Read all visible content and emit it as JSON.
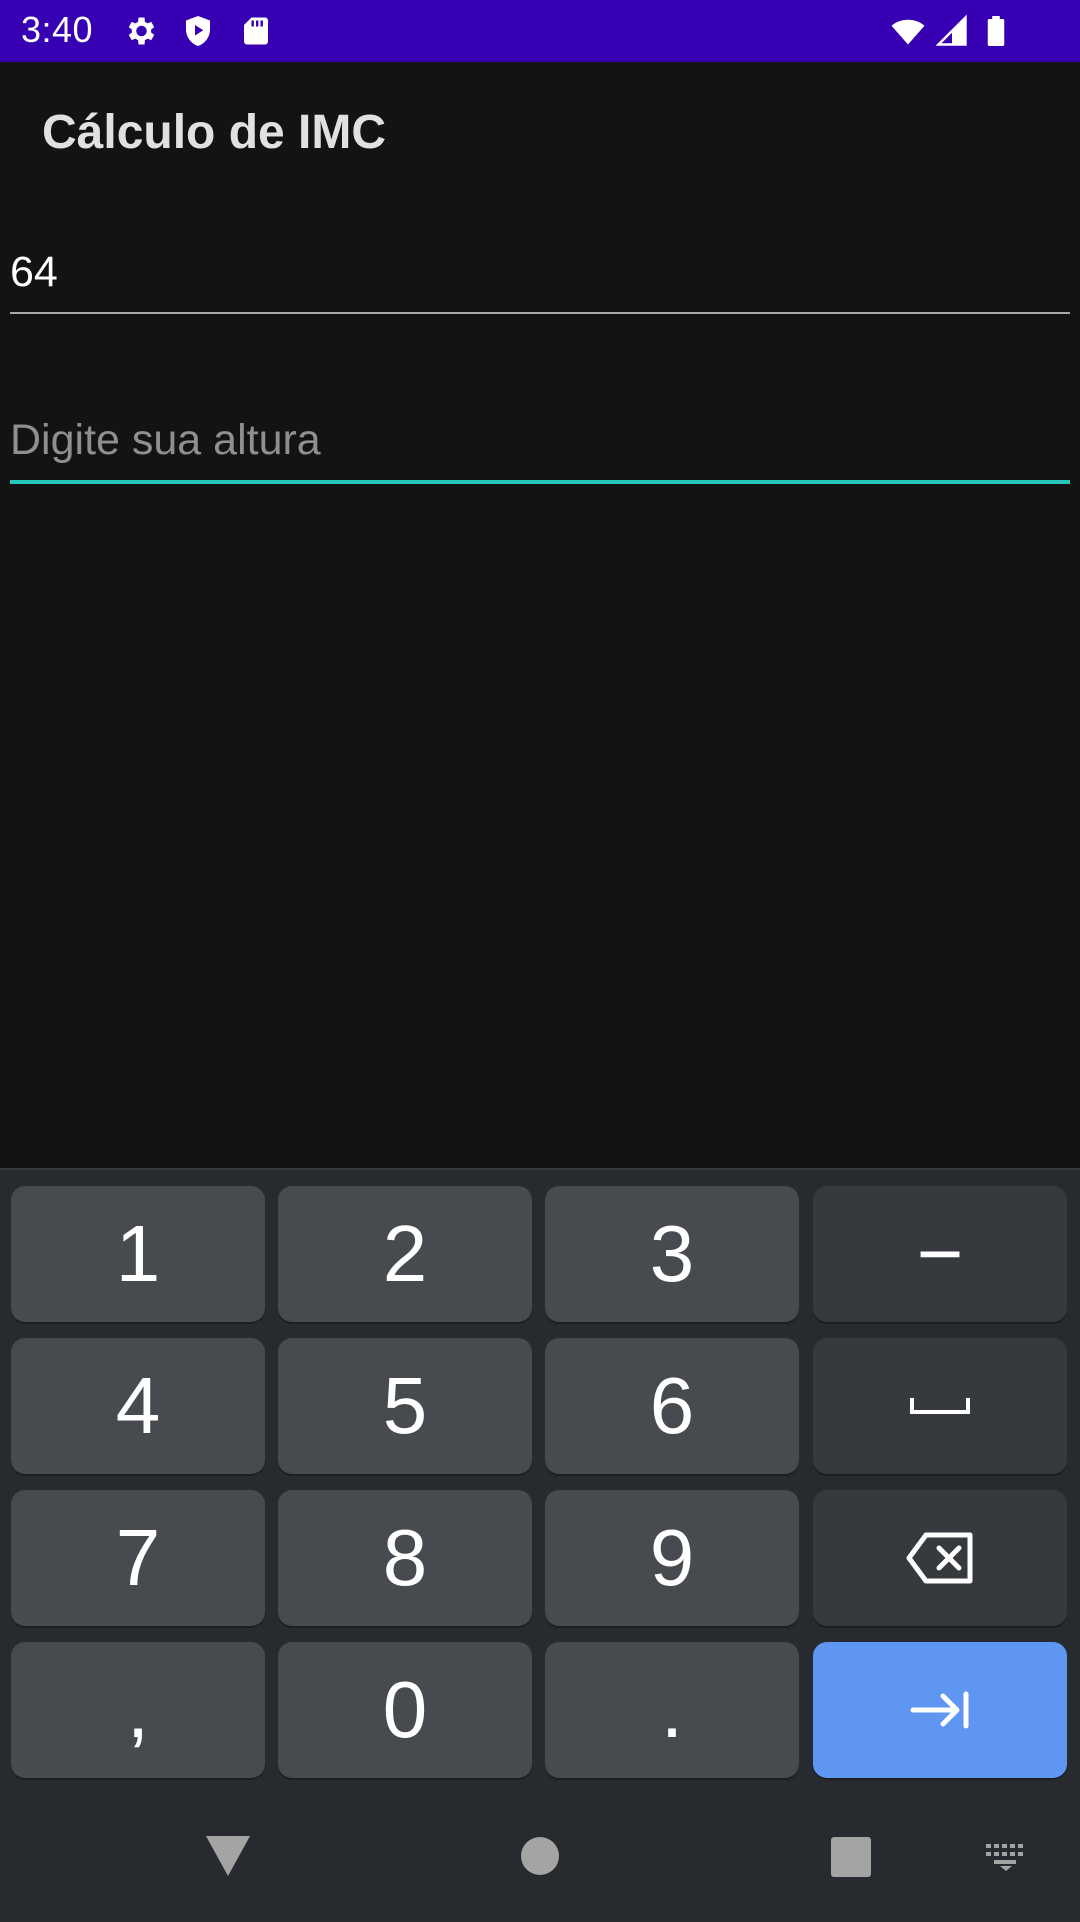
{
  "status_bar": {
    "time": "3:40",
    "icons": [
      "gear-icon",
      "play-protect-icon",
      "sd-card-icon",
      "wifi-icon",
      "signal-icon",
      "battery-icon"
    ],
    "background": "#3700b3"
  },
  "app": {
    "title": "Cálculo de IMC"
  },
  "weight_field": {
    "value": "64"
  },
  "height_field": {
    "placeholder": "Digite sua altura",
    "accent_color": "#26c6b8"
  },
  "keyboard": {
    "keys": {
      "k1": "1",
      "k2": "2",
      "k3": "3",
      "k_minus": "−",
      "k4": "4",
      "k5": "5",
      "k6": "6",
      "k7": "7",
      "k8": "8",
      "k9": "9",
      "k_comma": ",",
      "k0": "0",
      "k_period": "."
    },
    "icons": [
      "space-icon",
      "backspace-icon",
      "next-tab-icon"
    ],
    "action_color": "#5f96f2"
  },
  "nav_bar": {
    "icons": [
      "back-icon",
      "home-icon",
      "recents-icon",
      "keyboard-switch-icon"
    ]
  }
}
